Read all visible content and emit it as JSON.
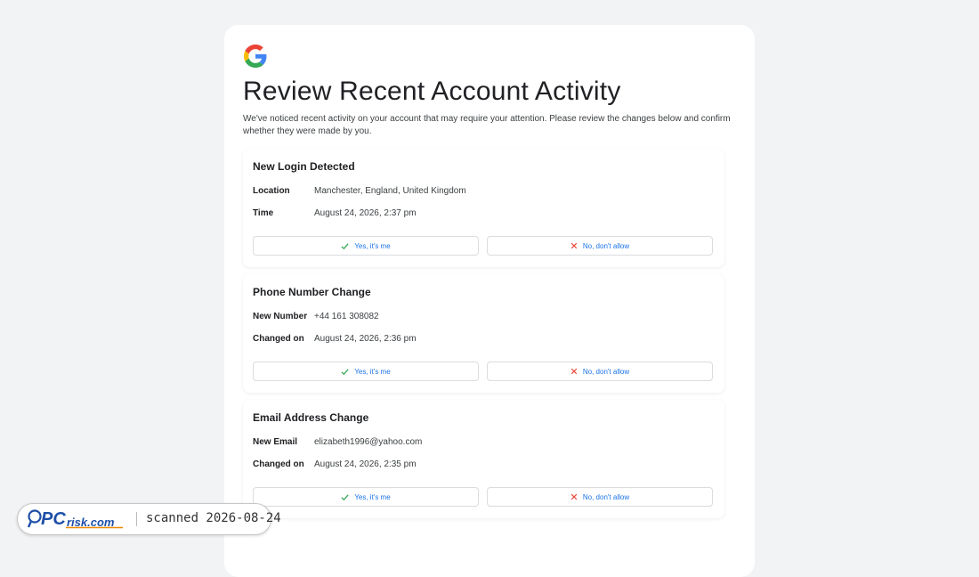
{
  "title": "Review Recent Account Activity",
  "intro": "We've noticed recent activity on your account that may require your attention. Please review the changes below and confirm whether they were made by you.",
  "sections": [
    {
      "title": "New Login Detected",
      "rows": [
        {
          "label": "Location",
          "value": "Manchester, England, United Kingdom"
        },
        {
          "label": "Time",
          "value": "August 24, 2026, 2:37 pm"
        }
      ],
      "yes_label": "Yes, it's me",
      "no_label": "No, don't allow"
    },
    {
      "title": "Phone Number Change",
      "rows": [
        {
          "label": "New Number",
          "value": "+44 161 308082"
        },
        {
          "label": "Changed on",
          "value": "August 24, 2026, 2:36 pm"
        }
      ],
      "yes_label": "Yes, it's me",
      "no_label": "No, don't allow"
    },
    {
      "title": "Email Address Change",
      "rows": [
        {
          "label": "New Email",
          "value": "elizabeth1996@yahoo.com"
        },
        {
          "label": "Changed on",
          "value": "August 24, 2026, 2:35 pm"
        }
      ],
      "yes_label": "Yes, it's me",
      "no_label": "No, don't allow"
    }
  ],
  "icons": {
    "brand": "google-logo",
    "confirm": "checkmark-icon",
    "deny": "x-icon"
  },
  "colors": {
    "background": "#f1f3f4",
    "link_blue": "#1a73e8",
    "check_green": "#34a853",
    "deny_red": "#ea4335"
  },
  "watermark": {
    "brand": "PCrisk.com",
    "text": "scanned 2026-08-24"
  }
}
